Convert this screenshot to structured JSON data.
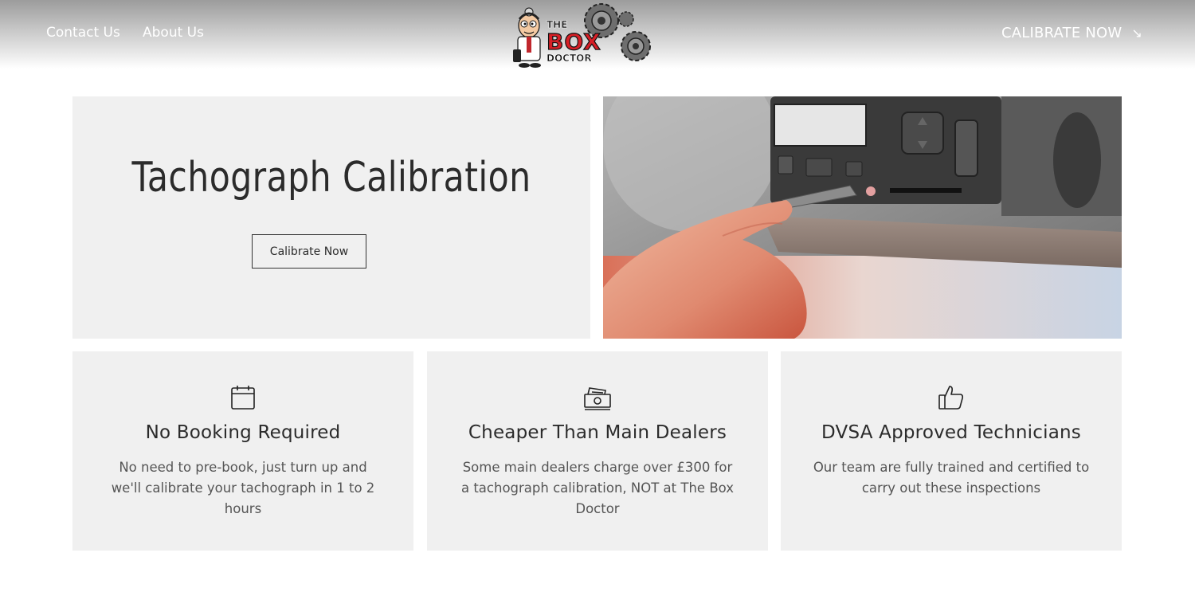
{
  "header": {
    "nav": [
      {
        "label": "Contact Us"
      },
      {
        "label": "About Us"
      }
    ],
    "cta_label": "CALIBRATE NOW",
    "cta_arrow": "↘",
    "logo": {
      "line1": "THE",
      "line2": "BOX",
      "line3": "DOCTOR"
    }
  },
  "hero": {
    "title": "Tachograph Calibration",
    "button_label": "Calibrate Now"
  },
  "features": [
    {
      "icon": "calendar-icon",
      "title": "No Booking Required",
      "text": "No need to pre-book, just turn up and we'll calibrate your tachograph in 1 to 2 hours"
    },
    {
      "icon": "money-icon",
      "title": "Cheaper Than Main Dealers",
      "text": "Some main dealers charge over £300 for a tachograph calibration, NOT at The Box Doctor"
    },
    {
      "icon": "thumbs-up-icon",
      "title": "DVSA Approved Technicians",
      "text": "Our team are fully trained and certified to carry out these inspections"
    }
  ],
  "colors": {
    "panel": "#f0f0f0",
    "text": "#2b2b2b",
    "logo_red": "#d71f26"
  }
}
